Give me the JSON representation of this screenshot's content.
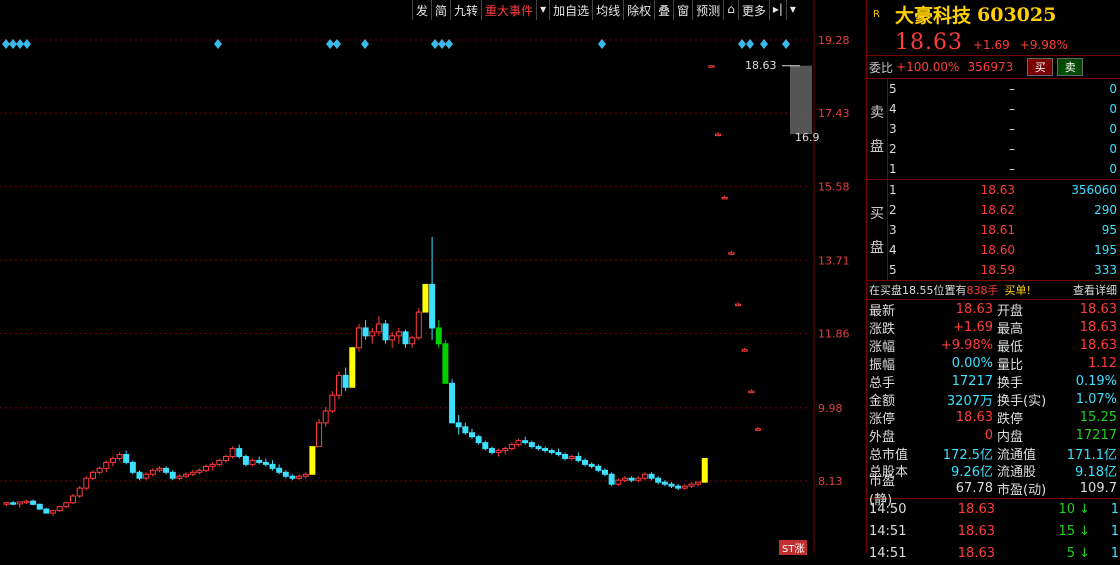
{
  "toolbar": {
    "items": [
      "发",
      "简",
      "九转",
      "重大事件",
      "▾",
      "加自选",
      "均线",
      "除权",
      "叠",
      "窗",
      "预测",
      "⌂",
      "更多",
      "▸|",
      "▾"
    ]
  },
  "price_axis": [
    "19.28",
    "17.43",
    "15.58",
    "13.71",
    "11.86",
    "9.98",
    "8.13"
  ],
  "markers": {
    "high_label": "18.63",
    "low_label": "16.9",
    "badge": "ST涨"
  },
  "header": {
    "r_icon": "R",
    "name": "大豪科技",
    "code": "603025",
    "price": "18.63",
    "change": "+1.69",
    "change_pct": "+9.98%"
  },
  "ratio": {
    "label": "委比",
    "value": "+100.00%",
    "diff": "356973",
    "buy_label": "买",
    "sell_label": "卖"
  },
  "sell_book": {
    "side_label": [
      "卖",
      "盘"
    ],
    "rows": [
      {
        "level": "5",
        "price": "–",
        "vol": "0"
      },
      {
        "level": "4",
        "price": "–",
        "vol": "0"
      },
      {
        "level": "3",
        "price": "–",
        "vol": "0"
      },
      {
        "level": "2",
        "price": "–",
        "vol": "0"
      },
      {
        "level": "1",
        "price": "–",
        "vol": "0"
      }
    ]
  },
  "buy_book": {
    "side_label": [
      "买",
      "盘"
    ],
    "rows": [
      {
        "level": "1",
        "price": "18.63",
        "vol": "356060"
      },
      {
        "level": "2",
        "price": "18.62",
        "vol": "290"
      },
      {
        "level": "3",
        "price": "18.61",
        "vol": "95"
      },
      {
        "level": "4",
        "price": "18.60",
        "vol": "195"
      },
      {
        "level": "5",
        "price": "18.59",
        "vol": "333"
      }
    ]
  },
  "info_bar": {
    "prefix": "在买盘18.55位置有",
    "qty": "838手",
    "suffix": "买单!",
    "link": "查看详细"
  },
  "stats": [
    {
      "k": "最新",
      "v": "18.63",
      "vc": "red",
      "k2": "开盘",
      "v2": "18.63",
      "v2c": "red"
    },
    {
      "k": "涨跌",
      "v": "+1.69",
      "vc": "red",
      "k2": "最高",
      "v2": "18.63",
      "v2c": "red"
    },
    {
      "k": "涨幅",
      "v": "+9.98%",
      "vc": "red",
      "k2": "最低",
      "v2": "18.63",
      "v2c": "red"
    },
    {
      "k": "振幅",
      "v": "0.00%",
      "vc": "cyan",
      "k2": "量比",
      "v2": "1.12",
      "v2c": "red"
    },
    {
      "k": "总手",
      "v": "17217",
      "vc": "cyan",
      "k2": "换手",
      "v2": "0.19%",
      "v2c": "cyan"
    },
    {
      "k": "金额",
      "v": "3207万",
      "vc": "cyan",
      "k2": "换手(实)",
      "v2": "1.07%",
      "v2c": "cyan"
    },
    {
      "k": "涨停",
      "v": "18.63",
      "vc": "red",
      "k2": "跌停",
      "v2": "15.25",
      "v2c": "green"
    },
    {
      "k": "外盘",
      "v": "0",
      "vc": "red",
      "k2": "内盘",
      "v2": "17217",
      "v2c": "green"
    },
    {
      "k": "总市值",
      "v": "172.5亿",
      "vc": "cyan",
      "k2": "流通值",
      "v2": "171.1亿",
      "v2c": "cyan"
    },
    {
      "k": "总股本",
      "v": "9.26亿",
      "vc": "cyan",
      "k2": "流通股",
      "v2": "9.18亿",
      "v2c": "cyan"
    },
    {
      "k": "市盈(静)",
      "v": "67.78",
      "vc": "white",
      "k2": "市盈(动)",
      "v2": "109.7",
      "v2c": "white"
    }
  ],
  "ticks": [
    {
      "time": "14:50",
      "price": "18.63",
      "vol": "10",
      "arrow": "↓",
      "count": "1"
    },
    {
      "time": "14:51",
      "price": "18.63",
      "vol": "15",
      "arrow": "↓",
      "count": "1"
    },
    {
      "time": "14:51",
      "price": "18.63",
      "vol": "5",
      "arrow": "↓",
      "count": "1"
    }
  ],
  "colors": {
    "up": "#ff3c3c",
    "down": "#3ee0ff",
    "limit_up": "#ffff00",
    "limit_down": "#00d000",
    "grid": "#7a0000"
  },
  "chart_data": {
    "type": "candlestick",
    "y_ticks": [
      19.28,
      17.43,
      15.58,
      13.71,
      11.86,
      9.98,
      8.13
    ],
    "ylim": [
      6.3,
      21.0
    ],
    "candles": [
      [
        7.55,
        7.6,
        7.5,
        7.58
      ],
      [
        7.58,
        7.62,
        7.52,
        7.55
      ],
      [
        7.55,
        7.6,
        7.45,
        7.6
      ],
      [
        7.6,
        7.65,
        7.55,
        7.62
      ],
      [
        7.62,
        7.66,
        7.52,
        7.54
      ],
      [
        7.54,
        7.56,
        7.4,
        7.42
      ],
      [
        7.42,
        7.45,
        7.3,
        7.32
      ],
      [
        7.32,
        7.4,
        7.25,
        7.38
      ],
      [
        7.38,
        7.5,
        7.35,
        7.48
      ],
      [
        7.48,
        7.6,
        7.45,
        7.58
      ],
      [
        7.58,
        7.8,
        7.55,
        7.75
      ],
      [
        7.75,
        8.0,
        7.7,
        7.95
      ],
      [
        7.95,
        8.25,
        7.9,
        8.2
      ],
      [
        8.2,
        8.4,
        8.15,
        8.35
      ],
      [
        8.35,
        8.5,
        8.3,
        8.45
      ],
      [
        8.45,
        8.65,
        8.35,
        8.6
      ],
      [
        8.6,
        8.75,
        8.5,
        8.7
      ],
      [
        8.7,
        8.85,
        8.65,
        8.8
      ],
      [
        8.8,
        8.9,
        8.55,
        8.6
      ],
      [
        8.6,
        8.65,
        8.3,
        8.35
      ],
      [
        8.35,
        8.4,
        8.15,
        8.2
      ],
      [
        8.2,
        8.35,
        8.15,
        8.3
      ],
      [
        8.3,
        8.45,
        8.25,
        8.4
      ],
      [
        8.4,
        8.5,
        8.35,
        8.45
      ],
      [
        8.45,
        8.5,
        8.3,
        8.35
      ],
      [
        8.35,
        8.4,
        8.15,
        8.2
      ],
      [
        8.2,
        8.3,
        8.15,
        8.25
      ],
      [
        8.25,
        8.35,
        8.2,
        8.3
      ],
      [
        8.3,
        8.4,
        8.25,
        8.35
      ],
      [
        8.35,
        8.45,
        8.3,
        8.4
      ],
      [
        8.4,
        8.55,
        8.35,
        8.5
      ],
      [
        8.5,
        8.6,
        8.4,
        8.55
      ],
      [
        8.55,
        8.7,
        8.5,
        8.65
      ],
      [
        8.65,
        8.8,
        8.6,
        8.75
      ],
      [
        8.75,
        9.0,
        8.7,
        8.95
      ],
      [
        8.95,
        9.05,
        8.7,
        8.75
      ],
      [
        8.75,
        8.8,
        8.5,
        8.55
      ],
      [
        8.55,
        8.7,
        8.5,
        8.65
      ],
      [
        8.65,
        8.75,
        8.55,
        8.6
      ],
      [
        8.6,
        8.7,
        8.5,
        8.55
      ],
      [
        8.55,
        8.65,
        8.4,
        8.45
      ],
      [
        8.45,
        8.55,
        8.3,
        8.35
      ],
      [
        8.35,
        8.4,
        8.2,
        8.25
      ],
      [
        8.25,
        8.3,
        8.15,
        8.2
      ],
      [
        8.2,
        8.3,
        8.15,
        8.25
      ],
      [
        8.25,
        8.35,
        8.2,
        8.3
      ],
      [
        8.3,
        9.0,
        8.3,
        9.0
      ],
      [
        9.0,
        9.7,
        9.0,
        9.6
      ],
      [
        9.6,
        10.0,
        9.5,
        9.9
      ],
      [
        9.9,
        10.4,
        9.85,
        10.3
      ],
      [
        10.3,
        10.9,
        10.2,
        10.8
      ],
      [
        10.8,
        11.0,
        10.4,
        10.5
      ],
      [
        10.5,
        11.5,
        10.5,
        11.5
      ],
      [
        11.5,
        12.1,
        11.4,
        12.0
      ],
      [
        12.0,
        12.2,
        11.7,
        11.8
      ],
      [
        11.8,
        12.0,
        11.6,
        11.9
      ],
      [
        11.9,
        12.3,
        11.8,
        12.1
      ],
      [
        12.1,
        12.2,
        11.6,
        11.7
      ],
      [
        11.7,
        11.9,
        11.5,
        11.8
      ],
      [
        11.8,
        12.0,
        11.6,
        11.9
      ],
      [
        11.9,
        11.95,
        11.5,
        11.6
      ],
      [
        11.6,
        11.8,
        11.5,
        11.75
      ],
      [
        11.75,
        12.5,
        11.7,
        12.4
      ],
      [
        12.4,
        13.1,
        12.4,
        13.1
      ],
      [
        13.1,
        14.3,
        11.7,
        12.0
      ],
      [
        12.0,
        12.2,
        11.5,
        11.6
      ],
      [
        11.6,
        11.7,
        10.6,
        10.6
      ],
      [
        10.6,
        10.7,
        9.6,
        9.6
      ],
      [
        9.6,
        9.8,
        9.3,
        9.5
      ],
      [
        9.5,
        9.6,
        9.3,
        9.35
      ],
      [
        9.35,
        9.45,
        9.2,
        9.25
      ],
      [
        9.25,
        9.3,
        9.05,
        9.1
      ],
      [
        9.1,
        9.15,
        8.9,
        8.95
      ],
      [
        8.95,
        9.0,
        8.8,
        8.85
      ],
      [
        8.85,
        8.95,
        8.75,
        8.9
      ],
      [
        8.9,
        9.0,
        8.8,
        8.95
      ],
      [
        8.95,
        9.1,
        8.9,
        9.05
      ],
      [
        9.05,
        9.2,
        9.0,
        9.15
      ],
      [
        9.15,
        9.25,
        9.05,
        9.1
      ],
      [
        9.1,
        9.15,
        8.95,
        9.0
      ],
      [
        9.0,
        9.05,
        8.9,
        8.95
      ],
      [
        8.95,
        9.0,
        8.85,
        8.9
      ],
      [
        8.9,
        8.95,
        8.8,
        8.85
      ],
      [
        8.85,
        8.95,
        8.75,
        8.8
      ],
      [
        8.8,
        8.85,
        8.65,
        8.7
      ],
      [
        8.7,
        8.8,
        8.65,
        8.75
      ],
      [
        8.75,
        8.85,
        8.6,
        8.65
      ],
      [
        8.65,
        8.7,
        8.5,
        8.55
      ],
      [
        8.55,
        8.6,
        8.45,
        8.5
      ],
      [
        8.5,
        8.55,
        8.35,
        8.4
      ],
      [
        8.4,
        8.45,
        8.25,
        8.3
      ],
      [
        8.3,
        8.35,
        8.0,
        8.05
      ],
      [
        8.05,
        8.2,
        8.0,
        8.15
      ],
      [
        8.15,
        8.25,
        8.1,
        8.2
      ],
      [
        8.2,
        8.25,
        8.1,
        8.15
      ],
      [
        8.15,
        8.25,
        8.1,
        8.2
      ],
      [
        8.2,
        8.35,
        8.15,
        8.3
      ],
      [
        8.3,
        8.35,
        8.15,
        8.2
      ],
      [
        8.2,
        8.25,
        8.05,
        8.1
      ],
      [
        8.1,
        8.15,
        8.0,
        8.05
      ],
      [
        8.05,
        8.1,
        7.95,
        8.0
      ],
      [
        8.0,
        8.05,
        7.9,
        7.95
      ],
      [
        7.95,
        8.05,
        7.9,
        8.0
      ],
      [
        8.0,
        8.1,
        7.95,
        8.05
      ],
      [
        8.05,
        8.1,
        8.0,
        8.1
      ],
      [
        8.1,
        8.7,
        8.1,
        8.7
      ],
      [
        18.63,
        18.63,
        18.63,
        18.63
      ],
      [
        16.9,
        16.95,
        16.85,
        16.9
      ],
      [
        15.3,
        15.35,
        15.25,
        15.3
      ],
      [
        13.9,
        13.95,
        13.85,
        13.9
      ],
      [
        12.6,
        12.65,
        12.55,
        12.6
      ],
      [
        11.45,
        11.5,
        11.4,
        11.45
      ],
      [
        10.4,
        10.45,
        10.35,
        10.4
      ],
      [
        9.45,
        9.5,
        9.4,
        9.45
      ]
    ],
    "limit_up_flags": [
      46,
      52,
      63,
      105
    ],
    "limit_down_flags": [
      65,
      66
    ],
    "diamonds_x": [
      6,
      13,
      20,
      27,
      218,
      330,
      337,
      365,
      435,
      442,
      449,
      602,
      742,
      750,
      764,
      786
    ]
  }
}
